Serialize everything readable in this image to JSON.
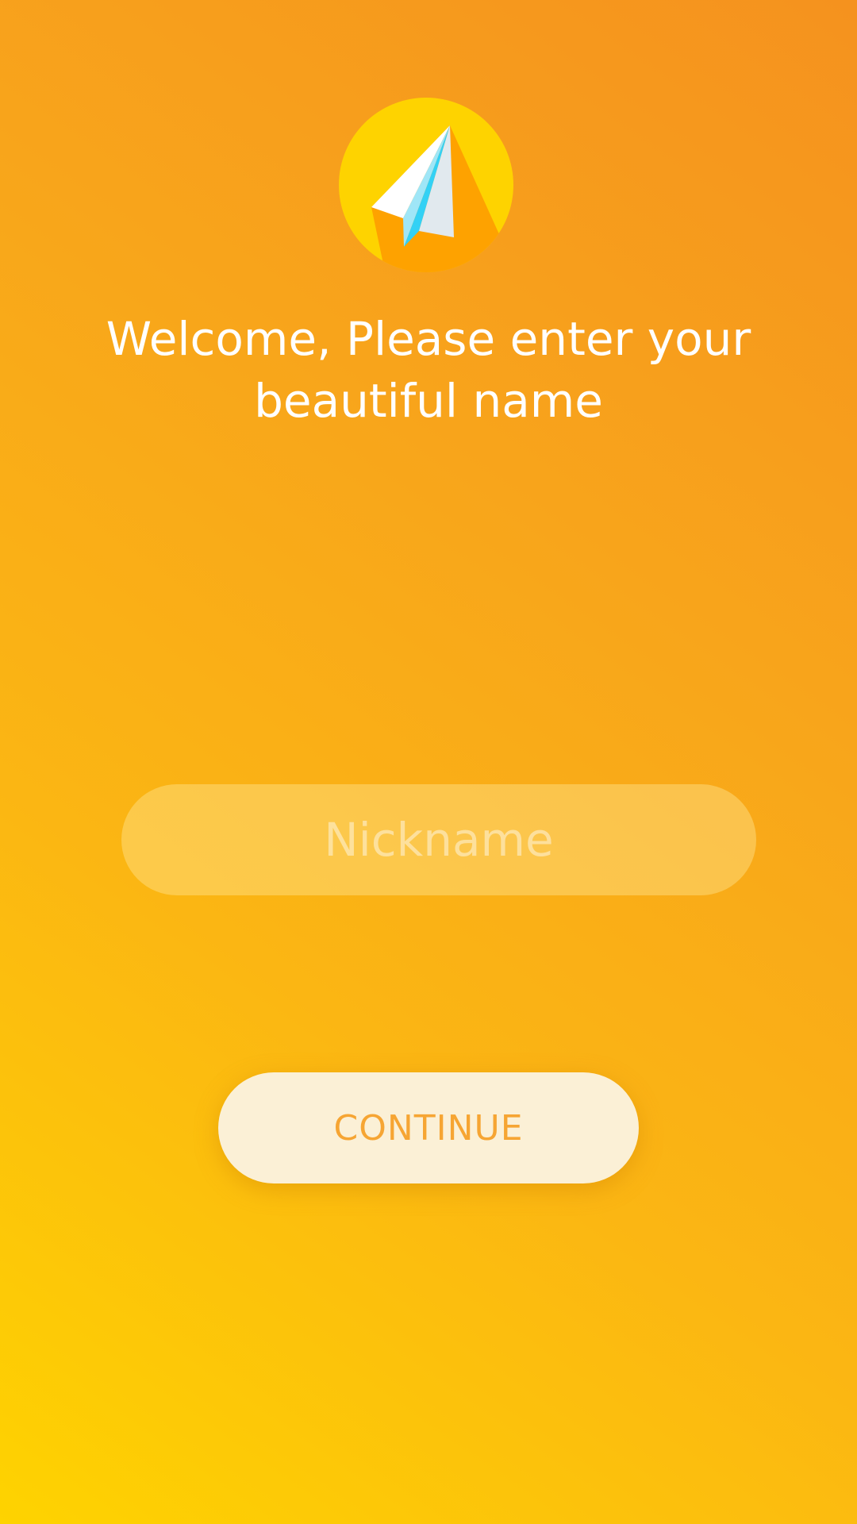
{
  "welcome": {
    "title": "Welcome, Please enter your beautiful name"
  },
  "nickname": {
    "placeholder": "Nickname",
    "value": ""
  },
  "continue_button": {
    "label": "CONTINUE"
  },
  "logo": {
    "icon": "paper-plane-icon"
  },
  "colors": {
    "background_gradient": [
      "#f5921e",
      "#fed300"
    ],
    "logo_circle": "#fed300",
    "logo_shadow": "#fea200",
    "plane_accent": "#33d1f5",
    "button_bg": "#fbf0d6",
    "button_text": "#f6a533",
    "title_text": "#ffffff"
  }
}
